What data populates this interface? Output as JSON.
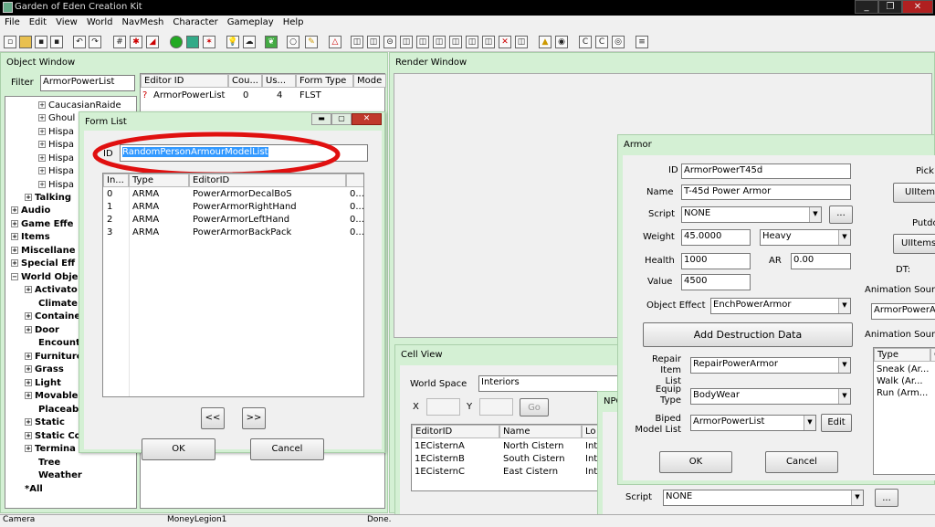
{
  "app": {
    "title": "Garden of Eden Creation Kit"
  },
  "menu": [
    "File",
    "Edit",
    "View",
    "World",
    "NavMesh",
    "Character",
    "Gameplay",
    "Help"
  ],
  "window_controls": {
    "minimize": "_",
    "restore": "❐",
    "close": "✕"
  },
  "object_window": {
    "title": "Object Window",
    "filter_label": "Filter",
    "filter_value": "ArmorPowerList",
    "tree": [
      {
        "label": "CaucasianRaide",
        "bold": false
      },
      {
        "label": "Ghoul",
        "bold": false
      },
      {
        "label": "Hispa",
        "bold": false
      },
      {
        "label": "Hispa",
        "bold": false
      },
      {
        "label": "Hispa",
        "bold": false
      },
      {
        "label": "Hispa",
        "bold": false
      },
      {
        "label": "Hispa",
        "bold": false
      },
      {
        "label": "Talking",
        "bold": true
      },
      {
        "label": "Audio",
        "bold": true
      },
      {
        "label": "Game Effe",
        "bold": true
      },
      {
        "label": "Items",
        "bold": true
      },
      {
        "label": "Miscellane",
        "bold": true
      },
      {
        "label": "Special Eff",
        "bold": true
      },
      {
        "label": "World Obje",
        "bold": true
      },
      {
        "label": "Activato",
        "bold": true
      },
      {
        "label": "Climate",
        "bold": true
      },
      {
        "label": "Containe",
        "bold": true
      },
      {
        "label": "Door",
        "bold": true
      },
      {
        "label": "Encount",
        "bold": true
      },
      {
        "label": "Furniture",
        "bold": true
      },
      {
        "label": "Grass",
        "bold": true
      },
      {
        "label": "Light",
        "bold": true
      },
      {
        "label": "Movable",
        "bold": true
      },
      {
        "label": "Placeab",
        "bold": true
      },
      {
        "label": "Static",
        "bold": true
      },
      {
        "label": "Static Co",
        "bold": true
      },
      {
        "label": "Termina",
        "bold": true
      },
      {
        "label": "Tree",
        "bold": true
      },
      {
        "label": "Weather",
        "bold": true
      },
      {
        "label": "*All",
        "bold": true
      }
    ],
    "columns": [
      "Editor ID",
      "Cou...",
      "Us...",
      "Form Type",
      "Mode"
    ],
    "rows": [
      {
        "editor_id": "ArmorPowerList",
        "count": "0",
        "uses": "4",
        "form_type": "FLST"
      }
    ]
  },
  "form_list": {
    "title": "Form List",
    "id_label": "ID",
    "id_value": "RandomPersonArmourModelList",
    "columns": [
      "In...",
      "Type",
      "EditorID",
      ""
    ],
    "rows": [
      {
        "index": "0",
        "type": "ARMA",
        "editor_id": "PowerArmorDecalBoS",
        "extra": "0..."
      },
      {
        "index": "1",
        "type": "ARMA",
        "editor_id": "PowerArmorRightHand",
        "extra": "0..."
      },
      {
        "index": "2",
        "type": "ARMA",
        "editor_id": "PowerArmorLeftHand",
        "extra": "0..."
      },
      {
        "index": "3",
        "type": "ARMA",
        "editor_id": "PowerArmorBackPack",
        "extra": "0..."
      }
    ],
    "prev": "<<",
    "next": ">>",
    "ok": "OK",
    "cancel": "Cancel"
  },
  "render_window": {
    "title": "Render Window"
  },
  "cell_view": {
    "title": "Cell View",
    "worldspace_label": "World Space",
    "worldspace_value": "Interiors",
    "x_label": "X",
    "y_label": "Y",
    "go": "Go",
    "columns": [
      "EditorID",
      "Name",
      "Lo"
    ],
    "rows": [
      {
        "editor_id": "1ECisternA",
        "name": "North Cistern",
        "loc": "Int"
      },
      {
        "editor_id": "1ECisternB",
        "name": "South Cistern",
        "loc": "Int"
      },
      {
        "editor_id": "1ECisternC",
        "name": "East Cistern",
        "loc": "Int"
      }
    ]
  },
  "npc_window": {
    "title": "NPC",
    "script_label": "Script",
    "script_value": "NONE",
    "browse": "..."
  },
  "armor": {
    "title": "Armor",
    "id_label": "ID",
    "id_value": "ArmorPowerT45d",
    "name_label": "Name",
    "name_value": "T-45d Power Armor",
    "script_label": "Script",
    "script_value": "NONE",
    "script_browse": "...",
    "weight_label": "Weight",
    "weight_value": "45.0000",
    "weight_class": "Heavy",
    "health_label": "Health",
    "health_value": "1000",
    "ar_label": "AR",
    "ar_value": "0.00",
    "value_label": "Value",
    "value_value": "4500",
    "object_effect_label": "Object Effect",
    "object_effect_value": "EnchPowerArmor",
    "add_destruction": "Add Destruction Data",
    "repair_label": "Repair Item List",
    "repair_value": "RepairPowerArmor",
    "equip_label": "Equip Type",
    "equip_value": "BodyWear",
    "biped_label": "Biped Model List",
    "biped_value": "ArmorPowerList",
    "biped_edit": "Edit",
    "ok": "OK",
    "cancel": "Cancel",
    "pickup_label": "Pick",
    "pickup_value": "UIItems",
    "putdown_label": "Putdo",
    "putdown_value": "UIItems",
    "dt_label": "DT:",
    "anim_sound_label": "Animation Sound",
    "anim_sound_value": "ArmorPowerA",
    "anim_sounds_label": "Animation Sound",
    "anim_columns": [
      "Type",
      "C"
    ],
    "anim_rows": [
      "Sneak (Ar...",
      "Walk (Ar...",
      "Run (Arm..."
    ]
  },
  "status": {
    "left": "Camera",
    "middle": "MoneyLegion1",
    "right": "Done."
  }
}
